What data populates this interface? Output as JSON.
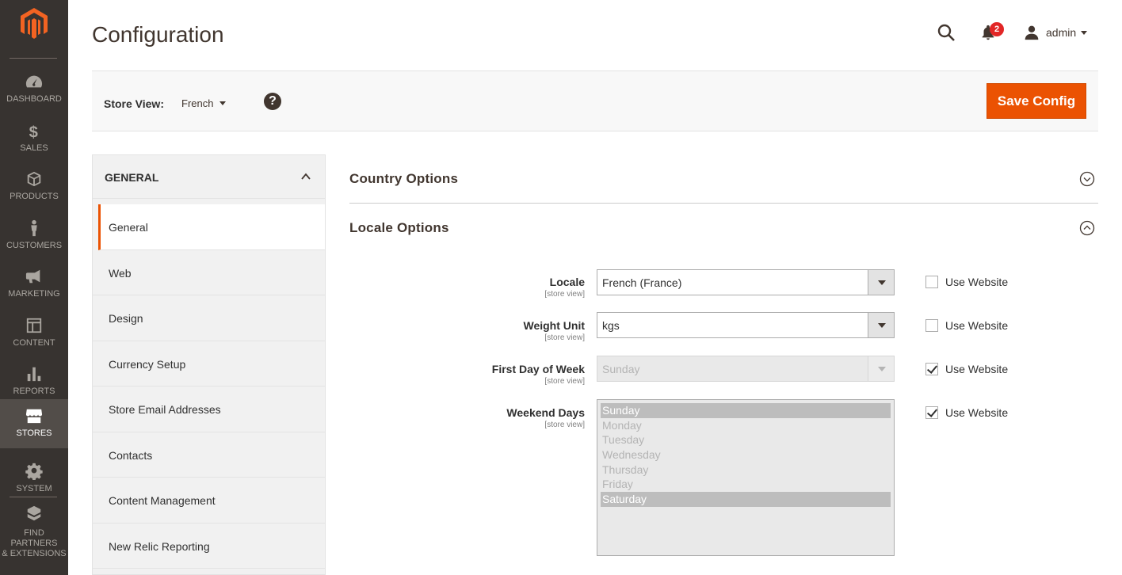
{
  "menu": {
    "items": [
      {
        "label": "DASHBOARD",
        "icon": "dashboard-icon"
      },
      {
        "label": "SALES",
        "icon": "dollar-icon"
      },
      {
        "label": "PRODUCTS",
        "icon": "cube-icon"
      },
      {
        "label": "CUSTOMERS",
        "icon": "person-icon"
      },
      {
        "label": "MARKETING",
        "icon": "megaphone-icon"
      },
      {
        "label": "CONTENT",
        "icon": "layout-icon"
      },
      {
        "label": "REPORTS",
        "icon": "bar-chart-icon"
      },
      {
        "label": "STORES",
        "icon": "storefront-icon"
      },
      {
        "label": "SYSTEM",
        "icon": "gear-icon"
      },
      {
        "label": "FIND PARTNERS\n& EXTENSIONS",
        "icon": "extensions-icon"
      }
    ],
    "active": "STORES"
  },
  "header": {
    "title": "Configuration",
    "notification_count": "2",
    "user_name": "admin"
  },
  "store_bar": {
    "label": "Store View:",
    "selected": "French",
    "help": "?",
    "save_label": "Save Config"
  },
  "nav": {
    "group": "GENERAL",
    "items": [
      {
        "label": "General"
      },
      {
        "label": "Web"
      },
      {
        "label": "Design"
      },
      {
        "label": "Currency Setup"
      },
      {
        "label": "Store Email Addresses"
      },
      {
        "label": "Contacts"
      },
      {
        "label": "Content Management"
      },
      {
        "label": "New Relic Reporting"
      }
    ],
    "active_index": 0
  },
  "sections": {
    "country": {
      "title": "Country Options"
    },
    "locale": {
      "title": "Locale Options"
    }
  },
  "fields": {
    "locale": {
      "label": "Locale",
      "scope": "[store view]",
      "value": "French (France)",
      "use_website": false
    },
    "weight_unit": {
      "label": "Weight Unit",
      "scope": "[store view]",
      "value": "kgs",
      "use_website": false
    },
    "first_day": {
      "label": "First Day of Week",
      "scope": "[store view]",
      "value": "Sunday",
      "use_website": true
    },
    "weekend_days": {
      "label": "Weekend Days",
      "scope": "[store view]",
      "options": [
        "Sunday",
        "Monday",
        "Tuesday",
        "Wednesday",
        "Thursday",
        "Friday",
        "Saturday"
      ],
      "selected": [
        "Sunday",
        "Saturday"
      ],
      "use_website": true
    },
    "use_website_label": "Use Website"
  },
  "colors": {
    "accent": "#eb5202",
    "menu_bg": "#373330",
    "notification": "#e22626"
  }
}
